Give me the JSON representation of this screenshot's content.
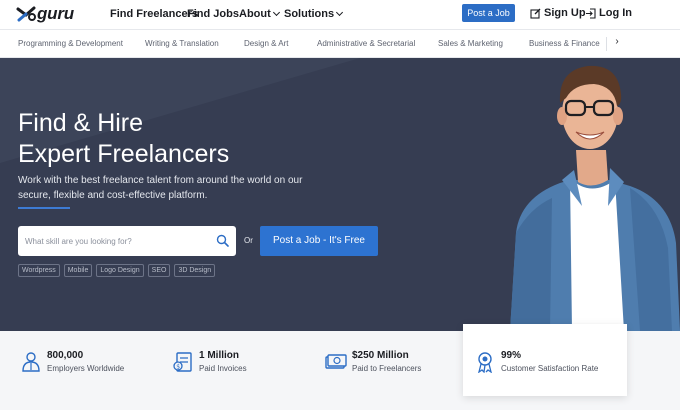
{
  "brand": {
    "logo_text": "guru"
  },
  "nav": {
    "find_freelancers": "Find Freelancers",
    "find_jobs": "Find Jobs",
    "about": "About",
    "solutions": "Solutions",
    "post_job": "Post a Job",
    "sign_up": "Sign Up",
    "log_in": "Log In"
  },
  "categories": [
    "Programming & Development",
    "Writing & Translation",
    "Design & Art",
    "Administrative & Secretarial",
    "Sales & Marketing",
    "Business & Finance"
  ],
  "hero": {
    "title_line1": "Find & Hire",
    "title_line2": "Expert Freelancers",
    "subtitle": "Work with the best freelance talent from around the world on our secure, flexible and cost-effective platform.",
    "search_placeholder": "What skill are you looking for?",
    "or_text": "Or",
    "cta": "Post a Job - It's Free",
    "tags": [
      "Wordpress",
      "Mobile",
      "Logo Design",
      "SEO",
      "3D Design"
    ]
  },
  "stats": [
    {
      "value": "800,000",
      "label": "Employers Worldwide",
      "icon": "employer-icon"
    },
    {
      "value": "1 Million",
      "label": "Paid Invoices",
      "icon": "invoice-icon"
    },
    {
      "value": "$250 Million",
      "label": "Paid to Freelancers",
      "icon": "money-icon"
    },
    {
      "value": "99%",
      "label": "Customer Satisfaction Rate",
      "icon": "award-ribbon-icon"
    }
  ],
  "colors": {
    "primary": "#2c6dc5",
    "hero_bg": "#363d52",
    "text_dark": "#1b1d22",
    "stats_bg": "#f5f6f8"
  }
}
